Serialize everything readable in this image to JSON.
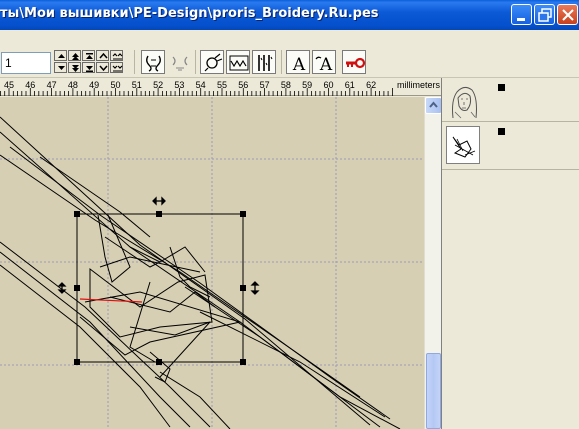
{
  "window": {
    "title": "ты\\Мои вышивки\\PE-Design\\proris_Broidery.Ru.pes"
  },
  "titlebar_buttons": [
    "minimize-icon",
    "restore-icon",
    "close-icon"
  ],
  "toolbar": {
    "value_field": "1",
    "tools": [
      {
        "name": "auto-punch-tool",
        "icon": "auto-punch-icon"
      },
      {
        "name": "stitch-break-tool",
        "icon": "stitch-break-icon"
      },
      {
        "name": "sew-setting-tool",
        "icon": "sew-setting-icon"
      },
      {
        "name": "zigzag-stitch-tool",
        "icon": "zigzag-icon"
      },
      {
        "name": "satin-stitch-tool",
        "icon": "satin-icon"
      },
      {
        "name": "text-tool",
        "icon": "text-A-icon",
        "label": "A"
      },
      {
        "name": "text-edit-tool",
        "icon": "text-edit-A-icon",
        "label": "A"
      },
      {
        "name": "key-tool",
        "icon": "key-icon"
      }
    ]
  },
  "ruler": {
    "labels": [
      "45",
      "46",
      "47",
      "48",
      "49",
      "50",
      "51",
      "52",
      "53",
      "54",
      "55",
      "56",
      "57",
      "58",
      "59",
      "60",
      "61",
      "62"
    ],
    "unit": "millimeters"
  },
  "colors": {
    "canvas": "#d6cfb4",
    "titlebar": "#0c5ad6",
    "stitch": "#000000",
    "stitch_highlight": "#e01010"
  },
  "patterns": [
    {
      "name": "icon-face-thumbnail",
      "icon": "icon-face-icon"
    },
    {
      "name": "fish-thumbnail",
      "icon": "fish-icon"
    }
  ]
}
